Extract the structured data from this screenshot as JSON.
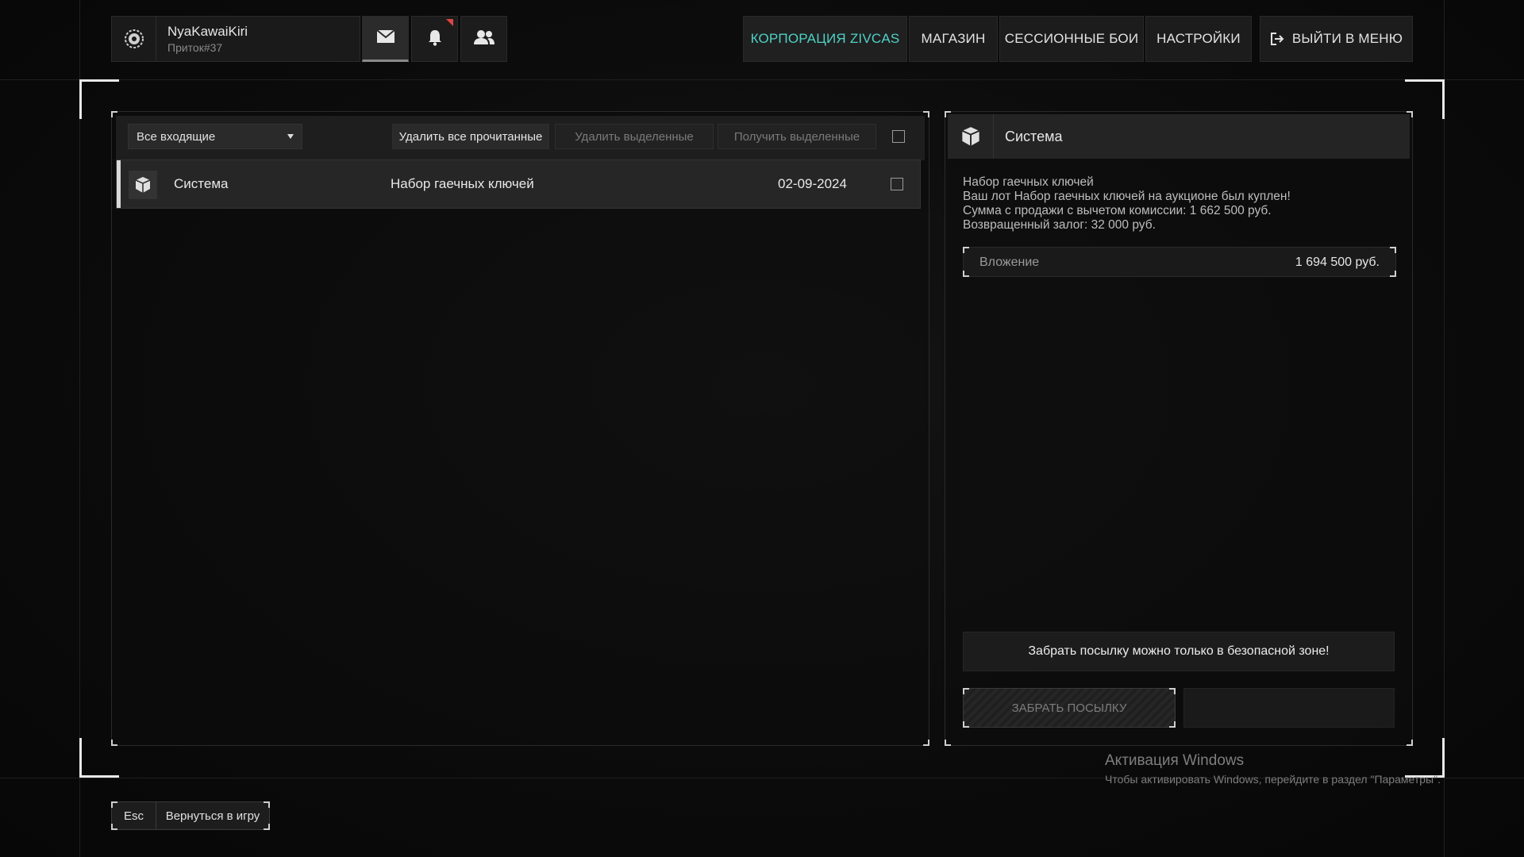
{
  "header": {
    "nickname": "NyaKawaiKiri",
    "tag": "Приток#37",
    "nav": [
      {
        "label": "КОРПОРАЦИЯ ZIVCAS"
      },
      {
        "label": "МАГАЗИН"
      },
      {
        "label": "СЕССИОННЫЕ БОИ"
      },
      {
        "label": "НАСТРОЙКИ"
      },
      {
        "label": "ВЫЙТИ В МЕНЮ"
      }
    ],
    "icons": {
      "mail": "mail-icon",
      "bell": "bell-icon",
      "friends": "users-icon",
      "emblem": "gear-emblem-icon",
      "exit": "exit-icon"
    }
  },
  "inbox": {
    "filter": "Все входящие",
    "delete_read": "Удалить все прочитанные",
    "delete_selected": "Удалить выделенные",
    "receive_selected": "Получить выделенные",
    "rows": [
      {
        "sender": "Система",
        "subject": "Набор гаечных ключей",
        "date": "02-09-2024"
      }
    ]
  },
  "detail": {
    "sender": "Система",
    "lines": [
      "Набор гаечных ключей",
      "Ваш лот Набор гаечных ключей на аукционе был куплен!",
      "Сумма с продажи с вычетом комиссии: 1 662 500 руб.",
      "Возвращенный залог: 32 000 руб."
    ],
    "attachment_label": "Вложение",
    "attachment_value": "1 694 500 руб.",
    "notice": "Забрать посылку можно только в безопасной зоне!",
    "take_button": "ЗАБРАТЬ ПОСЫЛКУ"
  },
  "footer": {
    "esc_key": "Esc",
    "back_label": "Вернуться в игру"
  },
  "watermark": {
    "title": "Активация Windows",
    "text": "Чтобы активировать Windows, перейдите в раздел \"Параметры\"."
  },
  "colors": {
    "accent": "#4fd1c5",
    "notif": "#e04545"
  }
}
